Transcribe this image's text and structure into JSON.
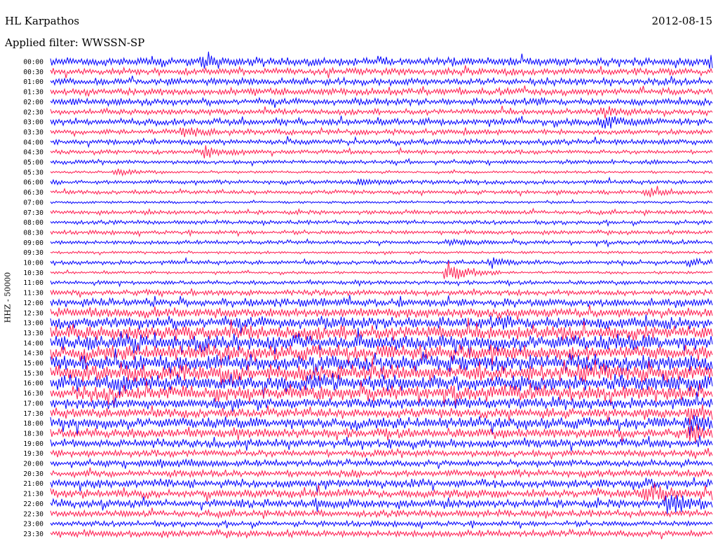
{
  "header": {
    "station": "HL Karpathos",
    "date": "2012-08-15",
    "filter": "Applied filter: WWSSN-SP"
  },
  "chart_data": {
    "type": "line",
    "title": "HL Karpathos",
    "subtitle": "Applied filter: WWSSN-SP",
    "date": "2012-08-15",
    "ylabel": "HHZ - 50000",
    "xlabel": "",
    "rows": [
      "00:00",
      "00:30",
      "01:00",
      "01:30",
      "02:00",
      "02:30",
      "03:00",
      "03:30",
      "04:00",
      "04:30",
      "05:00",
      "05:30",
      "06:00",
      "06:30",
      "07:00",
      "07:30",
      "08:00",
      "08:30",
      "09:00",
      "09:30",
      "10:00",
      "10:30",
      "11:00",
      "11:30",
      "12:00",
      "12:30",
      "13:00",
      "13:30",
      "14:00",
      "14:30",
      "15:00",
      "15:30",
      "16:00",
      "16:30",
      "17:00",
      "17:30",
      "18:00",
      "18:30",
      "19:00",
      "19:30",
      "20:00",
      "20:30",
      "21:00",
      "21:30",
      "22:00",
      "22:30",
      "23:00",
      "23:30"
    ],
    "row_minutes": 30,
    "amplitude": [
      6,
      5,
      5,
      5,
      5,
      4,
      5,
      4,
      4,
      3,
      3,
      2,
      3,
      3,
      2,
      3,
      3,
      3,
      3,
      2,
      3,
      2,
      3,
      4,
      6,
      7,
      9,
      10,
      11,
      11,
      12,
      12,
      12,
      11,
      8,
      7,
      8,
      7,
      6,
      5,
      5,
      5,
      6,
      6,
      6,
      5,
      4,
      5
    ],
    "events": [
      {
        "row": "00:00",
        "minute": 7,
        "scale": 9
      },
      {
        "row": "00:00",
        "minute": 30,
        "scale": 10
      },
      {
        "row": "02:30",
        "minute": 25,
        "scale": 5
      },
      {
        "row": "03:00",
        "minute": 25,
        "scale": 7
      },
      {
        "row": "03:30",
        "minute": 6,
        "scale": 6
      },
      {
        "row": "04:30",
        "minute": 7,
        "scale": 8
      },
      {
        "row": "05:30",
        "minute": 3,
        "scale": 5
      },
      {
        "row": "06:00",
        "minute": 14,
        "scale": 4
      },
      {
        "row": "06:30",
        "minute": 27,
        "scale": 5
      },
      {
        "row": "09:00",
        "minute": 18,
        "scale": 4
      },
      {
        "row": "10:30",
        "minute": 18,
        "scale": 18
      },
      {
        "row": "10:00",
        "minute": 20,
        "scale": 5
      },
      {
        "row": "10:00",
        "minute": 29,
        "scale": 5
      },
      {
        "row": "17:30",
        "minute": 29,
        "scale": 9
      },
      {
        "row": "18:00",
        "minute": 29,
        "scale": 10
      },
      {
        "row": "18:30",
        "minute": 29,
        "scale": 10
      },
      {
        "row": "20:00",
        "minute": 5,
        "scale": 5
      },
      {
        "row": "22:00",
        "minute": 12,
        "scale": 5
      },
      {
        "row": "21:30",
        "minute": 27,
        "scale": 14
      },
      {
        "row": "22:00",
        "minute": 28,
        "scale": 14
      }
    ],
    "colors": {
      "odd": "#0000ff",
      "even": "#ff1b4f"
    }
  }
}
